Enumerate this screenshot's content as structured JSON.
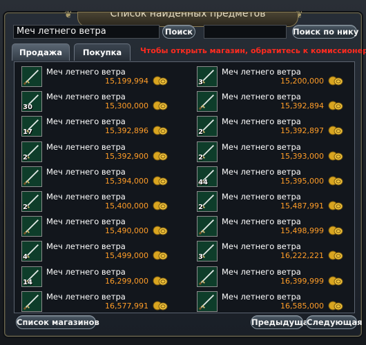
{
  "window": {
    "title": "Список найденных предметов"
  },
  "search": {
    "value": "Меч летнего ветра",
    "button": "Поиск",
    "nick_value": "",
    "nick_button": "Поиск по нику"
  },
  "tabs": [
    {
      "label": "Продажа",
      "active": true
    },
    {
      "label": "Покупка",
      "active": false
    }
  ],
  "notice": "Чтобы открыть магазин, обратитесь к комиссионеру.",
  "items": [
    {
      "name": "Меч летнего ветра",
      "price": "15,199,994",
      "qty": ""
    },
    {
      "name": "Меч летнего ветра",
      "price": "15,200,000",
      "qty": "3"
    },
    {
      "name": "Меч летнего ветра",
      "price": "15,300,000",
      "qty": "30"
    },
    {
      "name": "Меч летнего ветра",
      "price": "15,392,894",
      "qty": ""
    },
    {
      "name": "Меч летнего ветра",
      "price": "15,392,896",
      "qty": "17"
    },
    {
      "name": "Меч летнего ветра",
      "price": "15,392,897",
      "qty": "2"
    },
    {
      "name": "Меч летнего ветра",
      "price": "15,392,900",
      "qty": "2"
    },
    {
      "name": "Меч летнего ветра",
      "price": "15,393,000",
      "qty": "2"
    },
    {
      "name": "Меч летнего ветра",
      "price": "15,394,000",
      "qty": ""
    },
    {
      "name": "Меч летнего ветра",
      "price": "15,395,000",
      "qty": "44"
    },
    {
      "name": "Меч летнего ветра",
      "price": "15,400,000",
      "qty": "2"
    },
    {
      "name": "Меч летнего ветра",
      "price": "15,487,991",
      "qty": "2"
    },
    {
      "name": "Меч летнего ветра",
      "price": "15,490,000",
      "qty": ""
    },
    {
      "name": "Меч летнего ветра",
      "price": "15,498,999",
      "qty": ""
    },
    {
      "name": "Меч летнего ветра",
      "price": "15,499,000",
      "qty": "4"
    },
    {
      "name": "Меч летнего ветра",
      "price": "16,222,221",
      "qty": "3"
    },
    {
      "name": "Меч летнего ветра",
      "price": "16,299,000",
      "qty": "14"
    },
    {
      "name": "Меч летнего ветра",
      "price": "16,399,999",
      "qty": ""
    },
    {
      "name": "Меч летнего ветра",
      "price": "16,577,991",
      "qty": ""
    },
    {
      "name": "Меч летнего ветра",
      "price": "16,585,000",
      "qty": ""
    }
  ],
  "footer": {
    "shops_button": "Список магазинов",
    "prev_button": "Предыдущая",
    "next_button": "Следующая"
  },
  "colors": {
    "price": "#ff9d28",
    "notice": "#ff2b1f",
    "slot_bg": "#0e3d2a"
  }
}
